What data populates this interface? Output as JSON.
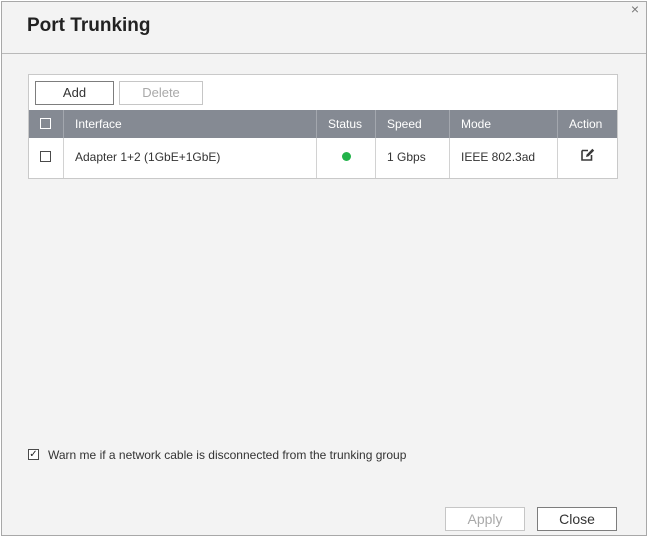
{
  "dialog": {
    "title": "Port Trunking",
    "close_glyph": "×"
  },
  "toolbar": {
    "add_label": "Add",
    "delete_label": "Delete"
  },
  "grid": {
    "columns": [
      "Interface",
      "Status",
      "Speed",
      "Mode",
      "Action"
    ],
    "rows": [
      {
        "interface": "Adapter 1+2 (1GbE+1GbE)",
        "status": "connected",
        "speed": "1 Gbps",
        "mode": "IEEE 802.3ad",
        "action_icon": "edit-icon"
      }
    ]
  },
  "warning": {
    "checked": true,
    "check_glyph": "✓",
    "label": "Warn me if a network cable is disconnected from the trunking group"
  },
  "footer": {
    "apply_label": "Apply",
    "close_label": "Close"
  },
  "colors": {
    "header_bg": "#858a93",
    "status_ok": "#22b34a",
    "dialog_bg": "#f3f3f3"
  }
}
